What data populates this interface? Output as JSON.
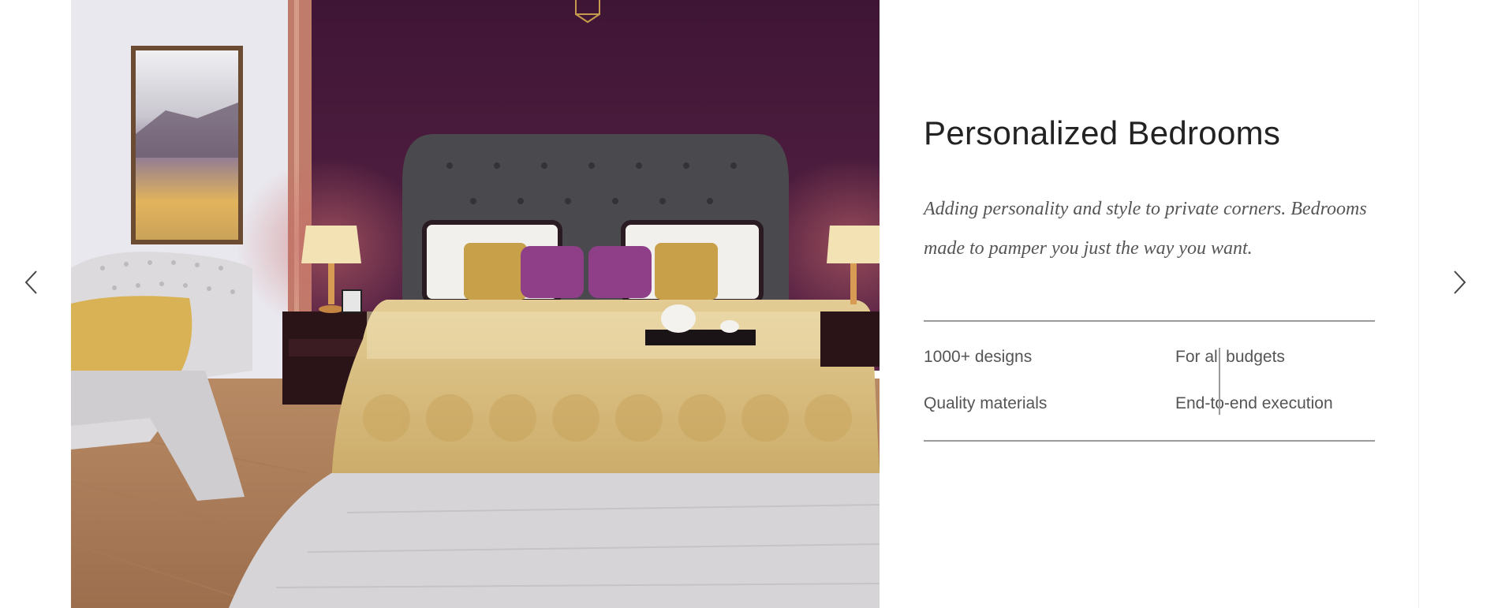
{
  "slide": {
    "title": "Personalized Bedrooms",
    "description": "Adding personality and style to private corners. Bedrooms made to pamper you just the way you want.",
    "features": [
      "1000+ designs",
      "For all budgets",
      "Quality materials",
      "End-to-end execution"
    ],
    "image": "bedroom-photo"
  },
  "navigation": {
    "prev_icon": "chevron-left-icon",
    "next_icon": "chevron-right-icon"
  },
  "colors": {
    "wall_accent": "#4a1a3c",
    "text_title": "#222222",
    "text_body": "#555555",
    "rule": "#9a9a9a"
  }
}
